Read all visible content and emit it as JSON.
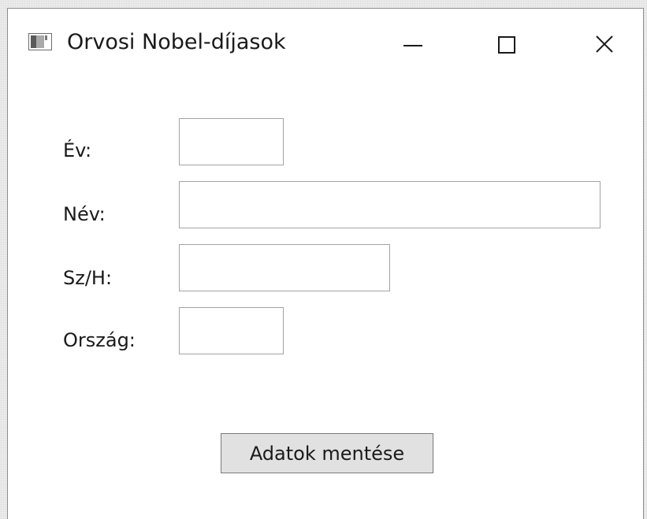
{
  "window": {
    "title": "Orvosi Nobel-díjasok",
    "controls": [
      "minimize",
      "maximize",
      "close"
    ]
  },
  "form": {
    "fields": [
      {
        "label": "Év:",
        "value": ""
      },
      {
        "label": "Név:",
        "value": ""
      },
      {
        "label": "Sz/H:",
        "value": ""
      },
      {
        "label": "Ország:",
        "value": ""
      }
    ],
    "save_label": "Adatok mentése"
  },
  "colors": {
    "window_bg": "#ffffff",
    "field_border": "#a3a3a3",
    "button_bg": "#e1e1e1",
    "button_border": "#7a7a7a",
    "text": "#1a1a1a"
  },
  "icons": [
    "app-icon",
    "minimize-icon",
    "maximize-icon",
    "close-icon"
  ]
}
